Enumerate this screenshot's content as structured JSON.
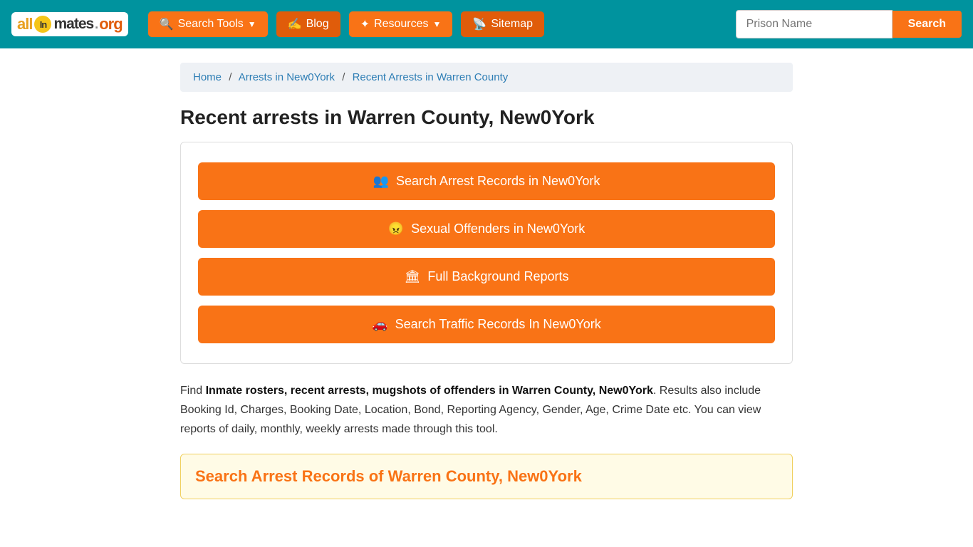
{
  "navbar": {
    "logo": {
      "part1": "all",
      "part2": "Inmates",
      "part3": ".org"
    },
    "search_tools_label": "Search Tools",
    "blog_label": "Blog",
    "resources_label": "Resources",
    "sitemap_label": "Sitemap",
    "prison_placeholder": "Prison Name",
    "search_btn_label": "Search"
  },
  "breadcrumb": {
    "home": "Home",
    "arrests": "Arrests in New0York",
    "current": "Recent Arrests in Warren County"
  },
  "page": {
    "title": "Recent arrests in Warren County, New0York",
    "buttons": [
      {
        "icon": "👥",
        "label": "Search Arrest Records in New0York"
      },
      {
        "icon": "😠",
        "label": "Sexual Offenders in New0York"
      },
      {
        "icon": "🏛",
        "label": "Full Background Reports"
      },
      {
        "icon": "🚗",
        "label": "Search Traffic Records In New0York"
      }
    ],
    "description_intro": "Find ",
    "description_bold": "Inmate rosters, recent arrests, mugshots of offenders in Warren County, New0York",
    "description_rest": ". Results also include Booking Id, Charges, Booking Date, Location, Bond, Reporting Agency, Gender, Age, Crime Date etc. You can view reports of daily, monthly, weekly arrests made through this tool.",
    "search_records_title": "Search Arrest Records of Warren County, New0York"
  }
}
